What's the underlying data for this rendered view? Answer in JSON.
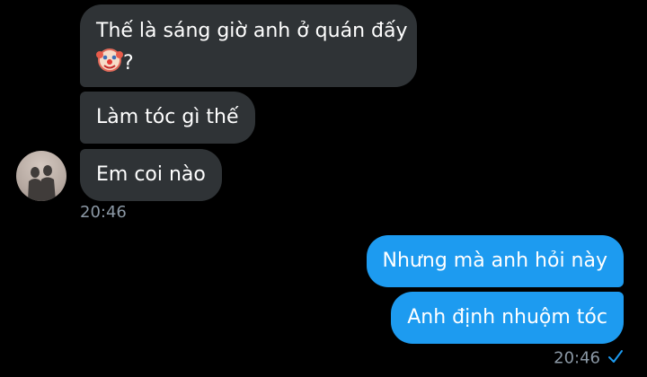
{
  "conversation": {
    "incoming": [
      {
        "line1": "Thế là sáng giờ anh ở quán đấy",
        "line2_suffix": "?",
        "emoji_icon": "clown-face-icon"
      },
      {
        "text": "Làm tóc gì thế"
      },
      {
        "text": "Em coi nào"
      }
    ],
    "incoming_time": "20:46",
    "outgoing": [
      {
        "text": "Nhưng mà anh hỏi này"
      },
      {
        "text": "Anh định nhuộm tóc"
      }
    ],
    "outgoing_time": "20:46",
    "read_icon": "checkmark-icon"
  },
  "colors": {
    "background": "#000000",
    "incoming_bubble": "#2f3336",
    "outgoing_bubble": "#1d9bf0",
    "timestamp": "#8b98a5",
    "check": "#1d9bf0"
  }
}
